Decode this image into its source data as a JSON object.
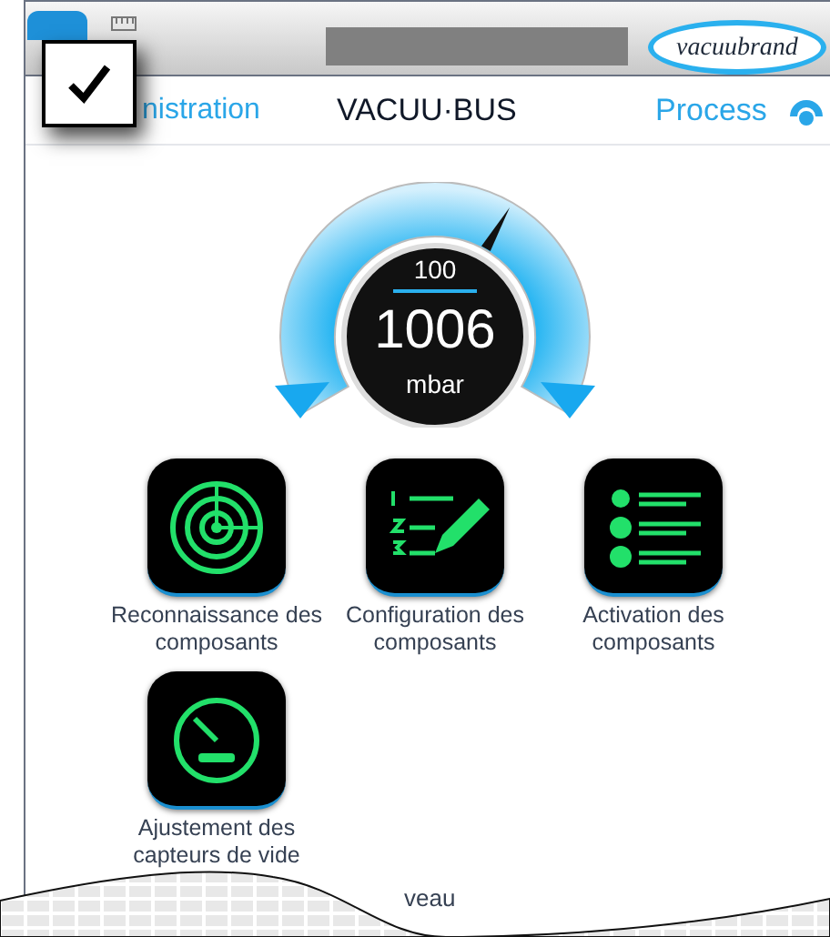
{
  "header": {
    "brand": "vacuubrand"
  },
  "overlay_checkbox": {
    "checked": true
  },
  "nav": {
    "back_label": "nistration",
    "title": "VACUU·BUS",
    "process_label": "Process"
  },
  "gauge": {
    "setpoint": "100",
    "value": "1006",
    "unit": "mbar"
  },
  "tiles": [
    {
      "kind": "radar",
      "label": "Reconnaissance des composants"
    },
    {
      "kind": "numbered-list",
      "label": "Configuration des composants"
    },
    {
      "kind": "checklist",
      "label": "Activation des composants"
    },
    {
      "kind": "speedometer",
      "label": "Ajustement des capteurs de vide"
    }
  ],
  "footer_fragment": "veau"
}
